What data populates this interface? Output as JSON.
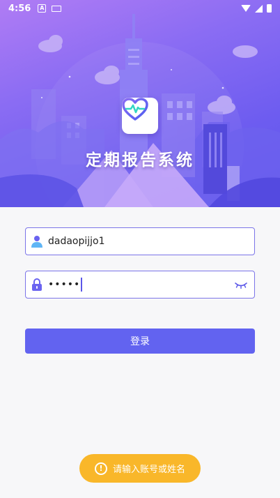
{
  "status_bar": {
    "time": "4:56",
    "a_icon_letter": "A"
  },
  "app": {
    "title": "定期报告系统"
  },
  "login": {
    "username_value": "dadaopijjo1",
    "password_value": "•••••",
    "login_label": "登录"
  },
  "toast": {
    "message": "请输入账号或姓名",
    "icon_glyph": "!"
  },
  "colors": {
    "accent": "#6263f0",
    "field_border": "#7b74e8",
    "toast": "#f9b72a"
  },
  "icons": [
    "user-icon",
    "lock-icon",
    "eye-closed-icon",
    "heart-pulse-icon",
    "alert-icon",
    "wifi-icon",
    "signal-icon",
    "battery-icon"
  ]
}
